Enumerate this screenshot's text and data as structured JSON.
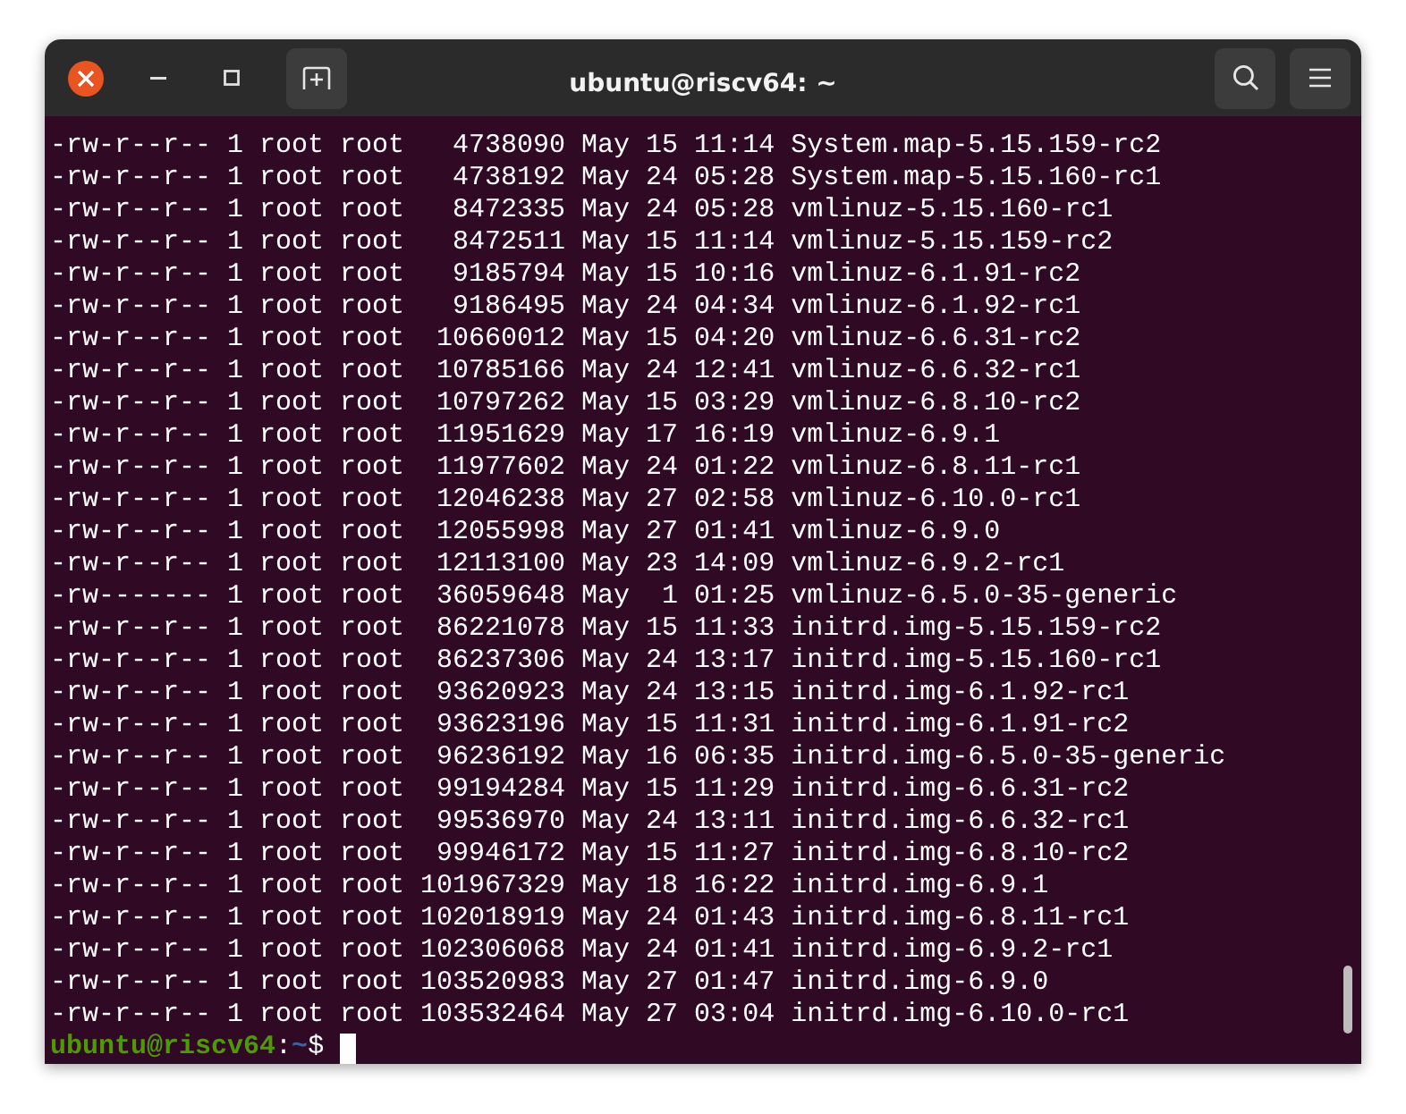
{
  "window": {
    "title": "ubuntu@riscv64: ~"
  },
  "lines": [
    "-rw-r--r-- 1 root root   4738090 May 15 11:14 System.map-5.15.159-rc2",
    "-rw-r--r-- 1 root root   4738192 May 24 05:28 System.map-5.15.160-rc1",
    "-rw-r--r-- 1 root root   8472335 May 24 05:28 vmlinuz-5.15.160-rc1",
    "-rw-r--r-- 1 root root   8472511 May 15 11:14 vmlinuz-5.15.159-rc2",
    "-rw-r--r-- 1 root root   9185794 May 15 10:16 vmlinuz-6.1.91-rc2",
    "-rw-r--r-- 1 root root   9186495 May 24 04:34 vmlinuz-6.1.92-rc1",
    "-rw-r--r-- 1 root root  10660012 May 15 04:20 vmlinuz-6.6.31-rc2",
    "-rw-r--r-- 1 root root  10785166 May 24 12:41 vmlinuz-6.6.32-rc1",
    "-rw-r--r-- 1 root root  10797262 May 15 03:29 vmlinuz-6.8.10-rc2",
    "-rw-r--r-- 1 root root  11951629 May 17 16:19 vmlinuz-6.9.1",
    "-rw-r--r-- 1 root root  11977602 May 24 01:22 vmlinuz-6.8.11-rc1",
    "-rw-r--r-- 1 root root  12046238 May 27 02:58 vmlinuz-6.10.0-rc1",
    "-rw-r--r-- 1 root root  12055998 May 27 01:41 vmlinuz-6.9.0",
    "-rw-r--r-- 1 root root  12113100 May 23 14:09 vmlinuz-6.9.2-rc1",
    "-rw------- 1 root root  36059648 May  1 01:25 vmlinuz-6.5.0-35-generic",
    "-rw-r--r-- 1 root root  86221078 May 15 11:33 initrd.img-5.15.159-rc2",
    "-rw-r--r-- 1 root root  86237306 May 24 13:17 initrd.img-5.15.160-rc1",
    "-rw-r--r-- 1 root root  93620923 May 24 13:15 initrd.img-6.1.92-rc1",
    "-rw-r--r-- 1 root root  93623196 May 15 11:31 initrd.img-6.1.91-rc2",
    "-rw-r--r-- 1 root root  96236192 May 16 06:35 initrd.img-6.5.0-35-generic",
    "-rw-r--r-- 1 root root  99194284 May 15 11:29 initrd.img-6.6.31-rc2",
    "-rw-r--r-- 1 root root  99536970 May 24 13:11 initrd.img-6.6.32-rc1",
    "-rw-r--r-- 1 root root  99946172 May 15 11:27 initrd.img-6.8.10-rc2",
    "-rw-r--r-- 1 root root 101967329 May 18 16:22 initrd.img-6.9.1",
    "-rw-r--r-- 1 root root 102018919 May 24 01:43 initrd.img-6.8.11-rc1",
    "-rw-r--r-- 1 root root 102306068 May 24 01:41 initrd.img-6.9.2-rc1",
    "-rw-r--r-- 1 root root 103520983 May 27 01:47 initrd.img-6.9.0",
    "-rw-r--r-- 1 root root 103532464 May 27 03:04 initrd.img-6.10.0-rc1"
  ],
  "prompt": {
    "user_host": "ubuntu@riscv64",
    "separator": ":",
    "path": "~",
    "symbol": "$"
  }
}
